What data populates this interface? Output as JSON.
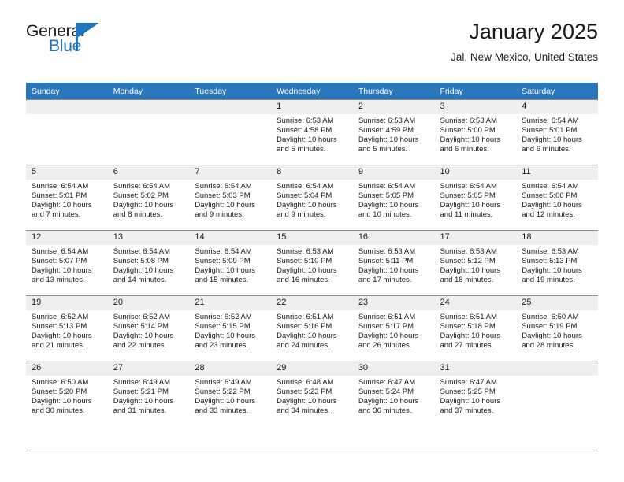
{
  "brand": {
    "name_top": "General",
    "name_bottom": "Blue",
    "accent_color": "#1d76bd"
  },
  "header": {
    "title": "January 2025",
    "subtitle": "Jal, New Mexico, United States"
  },
  "theme": {
    "header_row_bg": "#2b77bb",
    "daynum_band_bg": "#efefef",
    "grid_line": "#8a8a8a",
    "text": "#1a1a1a"
  },
  "weekday_headers": [
    "Sunday",
    "Monday",
    "Tuesday",
    "Wednesday",
    "Thursday",
    "Friday",
    "Saturday"
  ],
  "weeks": [
    [
      {
        "day": "",
        "empty": true
      },
      {
        "day": "",
        "empty": true
      },
      {
        "day": "",
        "empty": true
      },
      {
        "day": "1",
        "sunrise": "Sunrise: 6:53 AM",
        "sunset": "Sunset: 4:58 PM",
        "daylight": "Daylight: 10 hours and 5 minutes."
      },
      {
        "day": "2",
        "sunrise": "Sunrise: 6:53 AM",
        "sunset": "Sunset: 4:59 PM",
        "daylight": "Daylight: 10 hours and 5 minutes."
      },
      {
        "day": "3",
        "sunrise": "Sunrise: 6:53 AM",
        "sunset": "Sunset: 5:00 PM",
        "daylight": "Daylight: 10 hours and 6 minutes."
      },
      {
        "day": "4",
        "sunrise": "Sunrise: 6:54 AM",
        "sunset": "Sunset: 5:01 PM",
        "daylight": "Daylight: 10 hours and 6 minutes."
      }
    ],
    [
      {
        "day": "5",
        "sunrise": "Sunrise: 6:54 AM",
        "sunset": "Sunset: 5:01 PM",
        "daylight": "Daylight: 10 hours and 7 minutes."
      },
      {
        "day": "6",
        "sunrise": "Sunrise: 6:54 AM",
        "sunset": "Sunset: 5:02 PM",
        "daylight": "Daylight: 10 hours and 8 minutes."
      },
      {
        "day": "7",
        "sunrise": "Sunrise: 6:54 AM",
        "sunset": "Sunset: 5:03 PM",
        "daylight": "Daylight: 10 hours and 9 minutes."
      },
      {
        "day": "8",
        "sunrise": "Sunrise: 6:54 AM",
        "sunset": "Sunset: 5:04 PM",
        "daylight": "Daylight: 10 hours and 9 minutes."
      },
      {
        "day": "9",
        "sunrise": "Sunrise: 6:54 AM",
        "sunset": "Sunset: 5:05 PM",
        "daylight": "Daylight: 10 hours and 10 minutes."
      },
      {
        "day": "10",
        "sunrise": "Sunrise: 6:54 AM",
        "sunset": "Sunset: 5:05 PM",
        "daylight": "Daylight: 10 hours and 11 minutes."
      },
      {
        "day": "11",
        "sunrise": "Sunrise: 6:54 AM",
        "sunset": "Sunset: 5:06 PM",
        "daylight": "Daylight: 10 hours and 12 minutes."
      }
    ],
    [
      {
        "day": "12",
        "sunrise": "Sunrise: 6:54 AM",
        "sunset": "Sunset: 5:07 PM",
        "daylight": "Daylight: 10 hours and 13 minutes."
      },
      {
        "day": "13",
        "sunrise": "Sunrise: 6:54 AM",
        "sunset": "Sunset: 5:08 PM",
        "daylight": "Daylight: 10 hours and 14 minutes."
      },
      {
        "day": "14",
        "sunrise": "Sunrise: 6:54 AM",
        "sunset": "Sunset: 5:09 PM",
        "daylight": "Daylight: 10 hours and 15 minutes."
      },
      {
        "day": "15",
        "sunrise": "Sunrise: 6:53 AM",
        "sunset": "Sunset: 5:10 PM",
        "daylight": "Daylight: 10 hours and 16 minutes."
      },
      {
        "day": "16",
        "sunrise": "Sunrise: 6:53 AM",
        "sunset": "Sunset: 5:11 PM",
        "daylight": "Daylight: 10 hours and 17 minutes."
      },
      {
        "day": "17",
        "sunrise": "Sunrise: 6:53 AM",
        "sunset": "Sunset: 5:12 PM",
        "daylight": "Daylight: 10 hours and 18 minutes."
      },
      {
        "day": "18",
        "sunrise": "Sunrise: 6:53 AM",
        "sunset": "Sunset: 5:13 PM",
        "daylight": "Daylight: 10 hours and 19 minutes."
      }
    ],
    [
      {
        "day": "19",
        "sunrise": "Sunrise: 6:52 AM",
        "sunset": "Sunset: 5:13 PM",
        "daylight": "Daylight: 10 hours and 21 minutes."
      },
      {
        "day": "20",
        "sunrise": "Sunrise: 6:52 AM",
        "sunset": "Sunset: 5:14 PM",
        "daylight": "Daylight: 10 hours and 22 minutes."
      },
      {
        "day": "21",
        "sunrise": "Sunrise: 6:52 AM",
        "sunset": "Sunset: 5:15 PM",
        "daylight": "Daylight: 10 hours and 23 minutes."
      },
      {
        "day": "22",
        "sunrise": "Sunrise: 6:51 AM",
        "sunset": "Sunset: 5:16 PM",
        "daylight": "Daylight: 10 hours and 24 minutes."
      },
      {
        "day": "23",
        "sunrise": "Sunrise: 6:51 AM",
        "sunset": "Sunset: 5:17 PM",
        "daylight": "Daylight: 10 hours and 26 minutes."
      },
      {
        "day": "24",
        "sunrise": "Sunrise: 6:51 AM",
        "sunset": "Sunset: 5:18 PM",
        "daylight": "Daylight: 10 hours and 27 minutes."
      },
      {
        "day": "25",
        "sunrise": "Sunrise: 6:50 AM",
        "sunset": "Sunset: 5:19 PM",
        "daylight": "Daylight: 10 hours and 28 minutes."
      }
    ],
    [
      {
        "day": "26",
        "sunrise": "Sunrise: 6:50 AM",
        "sunset": "Sunset: 5:20 PM",
        "daylight": "Daylight: 10 hours and 30 minutes."
      },
      {
        "day": "27",
        "sunrise": "Sunrise: 6:49 AM",
        "sunset": "Sunset: 5:21 PM",
        "daylight": "Daylight: 10 hours and 31 minutes."
      },
      {
        "day": "28",
        "sunrise": "Sunrise: 6:49 AM",
        "sunset": "Sunset: 5:22 PM",
        "daylight": "Daylight: 10 hours and 33 minutes."
      },
      {
        "day": "29",
        "sunrise": "Sunrise: 6:48 AM",
        "sunset": "Sunset: 5:23 PM",
        "daylight": "Daylight: 10 hours and 34 minutes."
      },
      {
        "day": "30",
        "sunrise": "Sunrise: 6:47 AM",
        "sunset": "Sunset: 5:24 PM",
        "daylight": "Daylight: 10 hours and 36 minutes."
      },
      {
        "day": "31",
        "sunrise": "Sunrise: 6:47 AM",
        "sunset": "Sunset: 5:25 PM",
        "daylight": "Daylight: 10 hours and 37 minutes."
      },
      {
        "day": "",
        "empty": true
      }
    ]
  ]
}
